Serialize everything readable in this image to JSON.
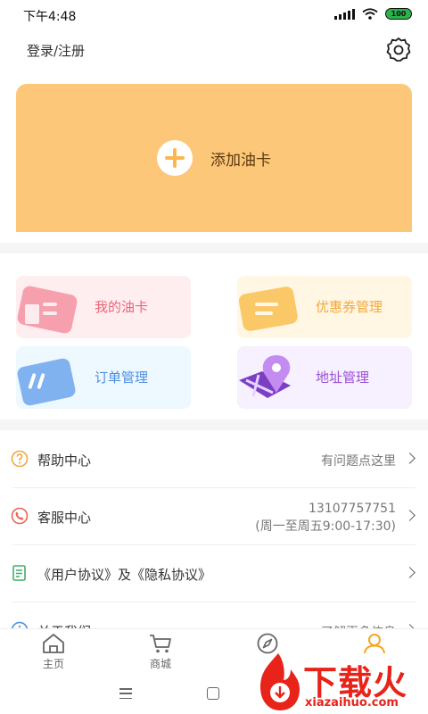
{
  "status_bar": {
    "time": "下午4:48",
    "battery": "100"
  },
  "header": {
    "login_label": "登录/注册"
  },
  "add_card": {
    "label": "添加油卡"
  },
  "tiles": [
    {
      "label": "我的油卡",
      "color": "#e8667a"
    },
    {
      "label": "优惠券管理",
      "color": "#f0a93c"
    },
    {
      "label": "订单管理",
      "color": "#4e8fe0"
    },
    {
      "label": "地址管理",
      "color": "#9b4fd4"
    }
  ],
  "menu": {
    "help": {
      "title": "帮助中心",
      "hint": "有问题点这里"
    },
    "service": {
      "title": "客服中心",
      "phone": "13107757751",
      "hours": "(周一至周五9:00-17:30)"
    },
    "agreement": {
      "title": "《用户协议》及《隐私协议》"
    },
    "about": {
      "title": "关于我们",
      "hint": "了解更多信息"
    }
  },
  "bottom_nav": [
    {
      "label": "主页",
      "icon": "home-icon"
    },
    {
      "label": "商城",
      "icon": "cart-icon"
    },
    {
      "label": "",
      "icon": "compass-icon"
    },
    {
      "label": "",
      "icon": "user-icon",
      "active": true
    }
  ],
  "watermark": {
    "text": "下载火",
    "domain": "xiazaihuo.com"
  },
  "colors": {
    "accent": "#fdc77a",
    "active_nav": "#f5a623",
    "watermark": "#e8231a"
  }
}
